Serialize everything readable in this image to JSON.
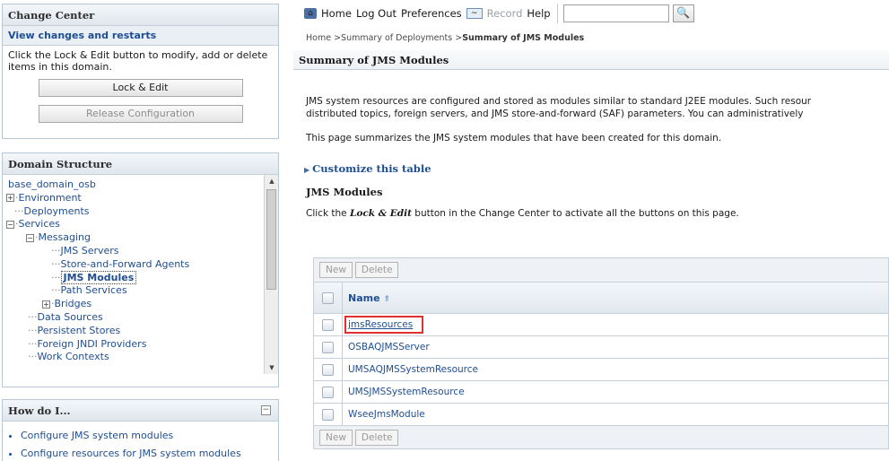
{
  "change_center": {
    "title": "Change Center",
    "subtitle": "View changes and restarts",
    "description": "Click the Lock & Edit button to modify, add or delete items in this domain.",
    "lock_edit_label": "Lock & Edit",
    "release_label": "Release Configuration"
  },
  "domain_structure": {
    "title": "Domain Structure",
    "items": [
      {
        "label": "base_domain_osb",
        "toggle": ""
      },
      {
        "label": "Environment",
        "toggle": "+"
      },
      {
        "label": "Deployments",
        "toggle": ""
      },
      {
        "label": "Services",
        "toggle": "−"
      },
      {
        "label": "Messaging",
        "toggle": "−"
      },
      {
        "label": "JMS Servers",
        "toggle": ""
      },
      {
        "label": "Store-and-Forward Agents",
        "toggle": ""
      },
      {
        "label": "JMS Modules",
        "toggle": "",
        "selected": true
      },
      {
        "label": "Path Services",
        "toggle": ""
      },
      {
        "label": "Bridges",
        "toggle": "+"
      },
      {
        "label": "Data Sources",
        "toggle": ""
      },
      {
        "label": "Persistent Stores",
        "toggle": ""
      },
      {
        "label": "Foreign JNDI Providers",
        "toggle": ""
      },
      {
        "label": "Work Contexts",
        "toggle": ""
      }
    ]
  },
  "how_do_i": {
    "title": "How do I...",
    "items": [
      "Configure JMS system modules",
      "Configure resources for JMS system modules"
    ]
  },
  "toolbar": {
    "home": "Home",
    "logout": "Log Out",
    "preferences": "Preferences",
    "record": "Record",
    "help": "Help",
    "search_value": ""
  },
  "breadcrumb": {
    "part1": "Home >Summary of Deployments >",
    "current": "Summary of JMS Modules"
  },
  "page": {
    "title": "Summary of JMS Modules",
    "desc_line1": "JMS system resources are configured and stored as modules similar to standard J2EE modules. Such resour",
    "desc_line2": "distributed topics, foreign servers, and JMS store-and-forward (SAF) parameters. You can administratively",
    "desc_line3": "This page summarizes the JMS system modules that have been created for this domain.",
    "customize_label": "Customize this table",
    "section_title": "JMS Modules",
    "instr_pre": "Click the ",
    "instr_em": "Lock & Edit",
    "instr_post": " button in the Change Center to activate all the buttons on this page."
  },
  "table": {
    "new_label": "New",
    "delete_label": "Delete",
    "column_name": "Name",
    "rows": [
      "jmsResources",
      "OSBAQJMSServer",
      "UMSAQJMSSystemResource",
      "UMSJMSSystemResource",
      "WseeJmsModule"
    ]
  }
}
